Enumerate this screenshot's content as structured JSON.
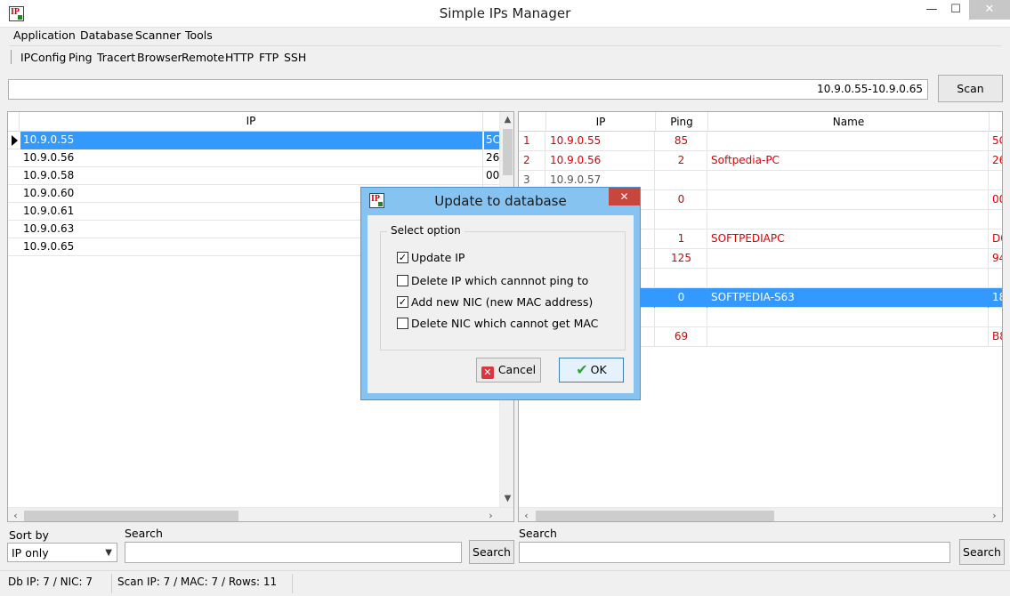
{
  "window": {
    "title": "Simple IPs Manager",
    "minimize_glyph": "—",
    "maximize_glyph": "☐",
    "close_glyph": "✕"
  },
  "menu": [
    "Application",
    "Database",
    "Scanner",
    "Tools"
  ],
  "toolbar": [
    "IPConfig",
    "Ping",
    "Tracert",
    "Browser",
    "Remote",
    "HTTP",
    "FTP",
    "SSH"
  ],
  "range": {
    "value": "10.9.0.55-10.9.0.65",
    "scan_label": "Scan"
  },
  "left_grid": {
    "header": "IP",
    "rows": [
      {
        "ip": "10.9.0.55",
        "extra": "5C",
        "selected": true
      },
      {
        "ip": "10.9.0.56",
        "extra": "26"
      },
      {
        "ip": "10.9.0.58",
        "extra": "00"
      },
      {
        "ip": "10.9.0.60",
        "extra": ""
      },
      {
        "ip": "10.9.0.61",
        "extra": ""
      },
      {
        "ip": "10.9.0.63",
        "extra": ""
      },
      {
        "ip": "10.9.0.65",
        "extra": ""
      }
    ]
  },
  "right_grid": {
    "headers": [
      "IP",
      "Ping",
      "Name"
    ],
    "rows": [
      {
        "n": "1",
        "ip": "10.9.0.55",
        "ping": "85",
        "name": "",
        "extra": "5C"
      },
      {
        "n": "2",
        "ip": "10.9.0.56",
        "ping": "2",
        "name": "Softpedia-PC",
        "extra": "26"
      },
      {
        "n": "3",
        "ip": "10.9.0.57",
        "ping": "",
        "name": "",
        "extra": "",
        "grey": true
      },
      {
        "n": "",
        "ip": "",
        "ping": "0",
        "name": "",
        "extra": "00"
      },
      {
        "n": "",
        "ip": "",
        "ping": "",
        "name": "",
        "extra": ""
      },
      {
        "n": "",
        "ip": "",
        "ping": "1",
        "name": "SOFTPEDIAPC",
        "extra": "D0"
      },
      {
        "n": "",
        "ip": "",
        "ping": "125",
        "name": "",
        "extra": "94"
      },
      {
        "n": "",
        "ip": "",
        "ping": "",
        "name": "",
        "extra": ""
      },
      {
        "n": "",
        "ip": "",
        "ping": "0",
        "name": "SOFTPEDIA-S63",
        "extra": "18",
        "selected": true
      },
      {
        "n": "",
        "ip": "",
        "ping": "",
        "name": "",
        "extra": ""
      },
      {
        "n": "",
        "ip": "",
        "ping": "69",
        "name": "",
        "extra": "B8"
      }
    ]
  },
  "bottom": {
    "sort_label": "Sort by",
    "sort_value": "IP only",
    "search_label_left": "Search",
    "search_button_left": "Search",
    "search_label_right": "Search",
    "search_button_right": "Search"
  },
  "status": {
    "db": "Db IP: 7 / NIC: 7",
    "scan": "Scan IP: 7 / MAC: 7 / Rows: 11"
  },
  "dialog": {
    "title": "Update to database",
    "group_label": "Select option",
    "options": [
      {
        "label": "Update IP",
        "checked": true
      },
      {
        "label": "Delete IP which cannnot ping to",
        "checked": false
      },
      {
        "label": "Add new NIC (new MAC address)",
        "checked": true
      },
      {
        "label": "Delete NIC which cannot get MAC",
        "checked": false
      }
    ],
    "cancel_label": "Cancel",
    "ok_label": "OK"
  }
}
